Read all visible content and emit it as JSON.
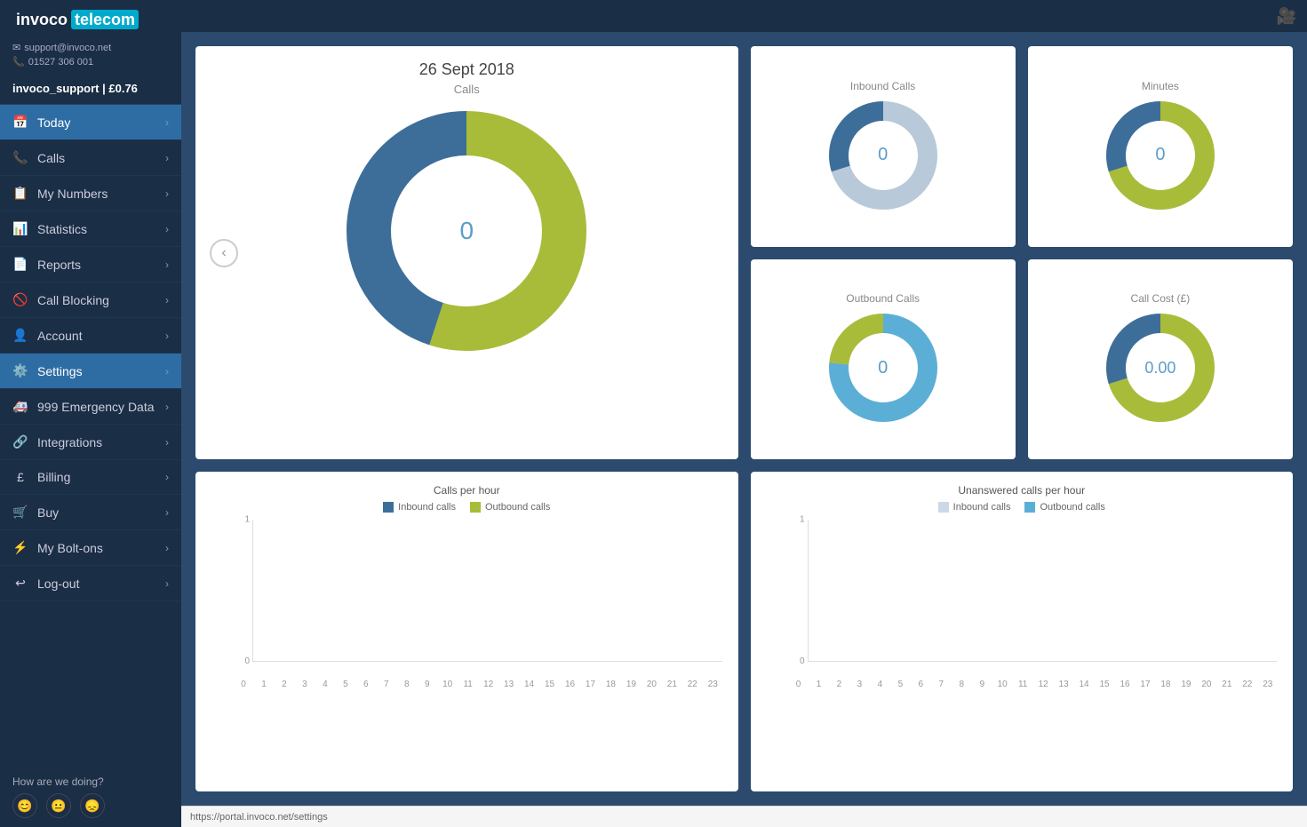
{
  "sidebar": {
    "logo": {
      "prefix": "invoco",
      "highlight": "telecom"
    },
    "user": {
      "email": "support@invoco.net",
      "phone": "01527 306 001"
    },
    "account_label": "invoco_support | £0.76",
    "items": [
      {
        "id": "today",
        "label": "Today",
        "icon": "📅",
        "active": true
      },
      {
        "id": "calls",
        "label": "Calls",
        "icon": "📞",
        "active": false
      },
      {
        "id": "my-numbers",
        "label": "My Numbers",
        "icon": "📋",
        "active": false
      },
      {
        "id": "statistics",
        "label": "Statistics",
        "icon": "📊",
        "active": false
      },
      {
        "id": "reports",
        "label": "Reports",
        "icon": "📄",
        "active": false
      },
      {
        "id": "call-blocking",
        "label": "Call Blocking",
        "icon": "🚫",
        "active": false
      },
      {
        "id": "account",
        "label": "Account",
        "icon": "👤",
        "active": false
      },
      {
        "id": "settings",
        "label": "Settings",
        "icon": "⚙️",
        "active": true
      },
      {
        "id": "999-emergency",
        "label": "999 Emergency Data",
        "icon": "🚑",
        "active": false
      },
      {
        "id": "integrations",
        "label": "Integrations",
        "icon": "🔗",
        "active": false
      },
      {
        "id": "billing",
        "label": "Billing",
        "icon": "£",
        "active": false
      },
      {
        "id": "buy",
        "label": "Buy",
        "icon": "🛒",
        "active": false
      },
      {
        "id": "my-bolt-ons",
        "label": "My Bolt-ons",
        "icon": "⚡",
        "active": false
      },
      {
        "id": "log-out",
        "label": "Log-out",
        "icon": "↩",
        "active": false
      }
    ],
    "feedback": {
      "label": "How are we doing?",
      "icons": [
        "😊",
        "😐",
        "😞"
      ]
    }
  },
  "main": {
    "date_card": {
      "title": "26 Sept 2018",
      "subtitle": "Calls",
      "center_value": "0"
    },
    "stat_cards": [
      {
        "title": "Inbound Calls",
        "value": "0",
        "colors": [
          "#b8c9d9",
          "#3d6e99"
        ]
      },
      {
        "title": "Minutes",
        "value": "0",
        "colors": [
          "#a8bc3a",
          "#3d6e99"
        ]
      },
      {
        "title": "Outbound Calls",
        "value": "0",
        "colors": [
          "#5bafd6",
          "#a8bc3a"
        ]
      },
      {
        "title": "Call Cost (£)",
        "value": "0.00",
        "colors": [
          "#a8bc3a",
          "#3d6e99"
        ]
      }
    ],
    "calls_per_hour": {
      "title": "Calls per hour",
      "legend": [
        {
          "label": "Inbound calls",
          "color": "#3d6e99"
        },
        {
          "label": "Outbound calls",
          "color": "#a8bc3a"
        }
      ],
      "y_max": "1",
      "y_min": "0",
      "x_labels": [
        "0",
        "1",
        "2",
        "3",
        "4",
        "5",
        "6",
        "7",
        "8",
        "9",
        "10",
        "11",
        "12",
        "13",
        "14",
        "15",
        "16",
        "17",
        "18",
        "19",
        "20",
        "21",
        "22",
        "23"
      ]
    },
    "unanswered_per_hour": {
      "title": "Unanswered calls per hour",
      "legend": [
        {
          "label": "Inbound calls",
          "color": "#ccd8e8"
        },
        {
          "label": "Outbound calls",
          "color": "#5bafd6"
        }
      ],
      "y_max": "1",
      "y_min": "0",
      "x_labels": [
        "0",
        "1",
        "2",
        "3",
        "4",
        "5",
        "6",
        "7",
        "8",
        "9",
        "10",
        "11",
        "12",
        "13",
        "14",
        "15",
        "16",
        "17",
        "18",
        "19",
        "20",
        "21",
        "22",
        "23"
      ]
    }
  },
  "statusbar": {
    "url": "https://portal.invoco.net/settings"
  }
}
